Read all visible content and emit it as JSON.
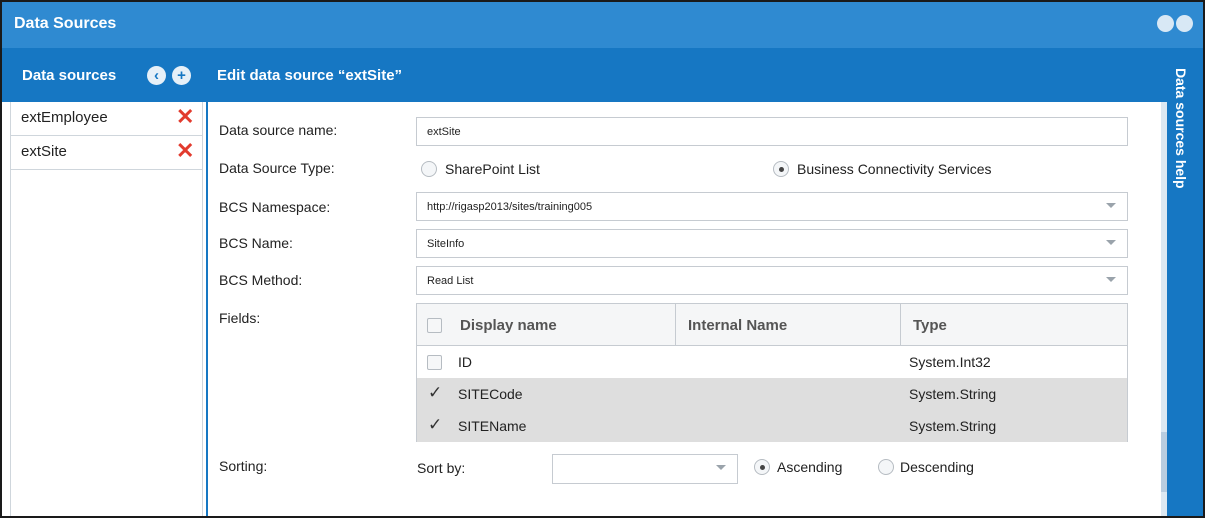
{
  "window": {
    "title": "Data Sources"
  },
  "left_panel": {
    "header": "Data sources",
    "items": [
      {
        "name": "extEmployee"
      },
      {
        "name": "extSite"
      }
    ],
    "delete_glyph": "✕"
  },
  "editor": {
    "header": "Edit data source “extSite”",
    "fields": {
      "name_label": "Data source name:",
      "name_value": "extSite",
      "type_label": "Data Source Type:",
      "type_options": [
        "SharePoint List",
        "Business Connectivity Services"
      ],
      "type_selected": "Business Connectivity Services",
      "ns_label": "BCS Namespace:",
      "ns_value": "http://rigasp2013/sites/training005",
      "bcsname_label": "BCS Name:",
      "bcsname_value": "SiteInfo",
      "method_label": "BCS Method:",
      "method_value": "Read List",
      "fields_label": "Fields:",
      "sorting_label": "Sorting:",
      "sortby_label": "Sort by:",
      "sort_options": [
        "Ascending",
        "Descending"
      ],
      "sort_selected": "Ascending"
    },
    "fields_table": {
      "columns": [
        "Display name",
        "Internal Name",
        "Type"
      ],
      "rows": [
        {
          "display_name": "ID",
          "internal_name": "",
          "type": "System.Int32",
          "checked": false
        },
        {
          "display_name": "SITECode",
          "internal_name": "",
          "type": "System.String",
          "checked": true
        },
        {
          "display_name": "SITEName",
          "internal_name": "",
          "type": "System.String",
          "checked": true
        }
      ],
      "check_glyph": "✓"
    }
  },
  "help_panel": {
    "label": "Data sources help"
  },
  "icons": {
    "close": "close-icon",
    "settings": "settings-icon",
    "back": "back-circle-icon",
    "add": "add-circle-icon"
  },
  "colors": {
    "title_bar": "#2f8ad1",
    "header_bar": "#1677c3",
    "delete": "#e23b2e",
    "selected_row": "#dedede"
  }
}
